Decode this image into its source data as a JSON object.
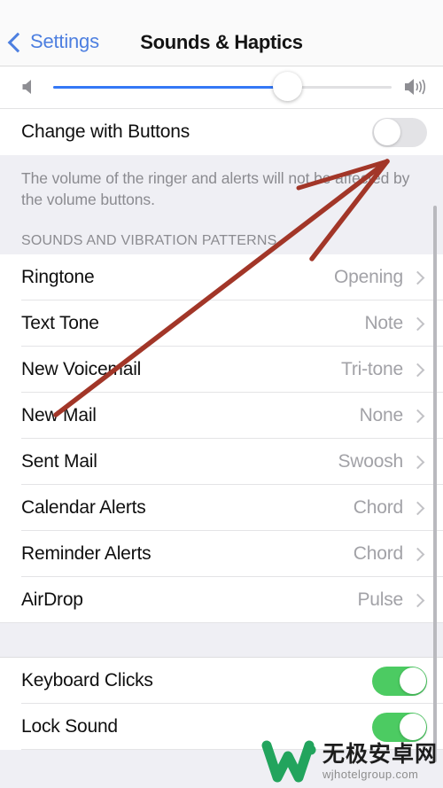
{
  "navbar": {
    "back_label": "Settings",
    "title": "Sounds & Haptics",
    "back_icon": "chevron-left-icon"
  },
  "volume": {
    "left_icon": "speaker-mute-icon",
    "right_icon": "speaker-waves-icon",
    "value_percent": 65
  },
  "change_with_buttons": {
    "label": "Change with Buttons",
    "state": "off",
    "footer": "The volume of the ringer and alerts will not be affected by the volume buttons."
  },
  "sounds_section": {
    "header": "SOUNDS AND VIBRATION PATTERNS",
    "rows": [
      {
        "label": "Ringtone",
        "value": "Opening"
      },
      {
        "label": "Text Tone",
        "value": "Note"
      },
      {
        "label": "New Voicemail",
        "value": "Tri-tone"
      },
      {
        "label": "New Mail",
        "value": "None"
      },
      {
        "label": "Sent Mail",
        "value": "Swoosh"
      },
      {
        "label": "Calendar Alerts",
        "value": "Chord"
      },
      {
        "label": "Reminder Alerts",
        "value": "Chord"
      },
      {
        "label": "AirDrop",
        "value": "Pulse"
      }
    ]
  },
  "toggles_section": {
    "rows": [
      {
        "label": "Keyboard Clicks",
        "state": "on"
      },
      {
        "label": "Lock Sound",
        "state": "on"
      }
    ]
  },
  "annotation": {
    "type": "hand-drawn-arrow",
    "color": "#a23628",
    "points_to": "change-with-buttons-toggle"
  },
  "watermark": {
    "logo": "w-logo-icon",
    "title": "无极安卓网",
    "url": "wjhotelgroup.com",
    "color": "#22a45d"
  },
  "colors": {
    "accent_blue": "#3478f6",
    "link_blue": "#4d7fe0",
    "toggle_on_green": "#4ccb62",
    "group_bg": "#efeff4",
    "value_gray": "#a2a2a7"
  }
}
